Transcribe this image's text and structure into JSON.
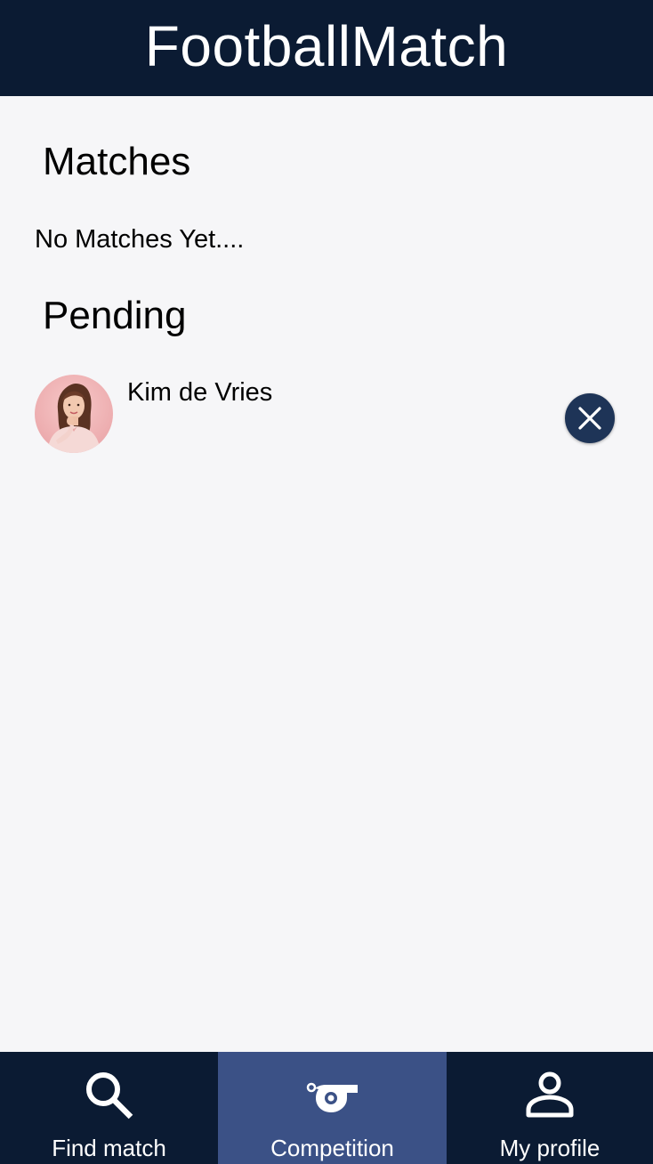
{
  "header": {
    "title": "FootballMatch"
  },
  "matches": {
    "title": "Matches",
    "empty_text": "No Matches Yet...."
  },
  "pending": {
    "title": "Pending",
    "items": [
      {
        "name": "Kim de Vries",
        "avatar": "profile-photo",
        "action_icon": "close-icon"
      }
    ]
  },
  "bottom_nav": {
    "items": [
      {
        "label": "Find match",
        "icon": "search-icon",
        "active": false
      },
      {
        "label": "Competition",
        "icon": "whistle-icon",
        "active": true
      },
      {
        "label": "My profile",
        "icon": "person-icon",
        "active": false
      }
    ]
  },
  "colors": {
    "header_bg": "#0b1b33",
    "nav_bg": "#0b1b33",
    "nav_active_bg": "#3b5186",
    "page_bg": "#f6f6f8",
    "remove_button_bg": "#1e3457"
  }
}
